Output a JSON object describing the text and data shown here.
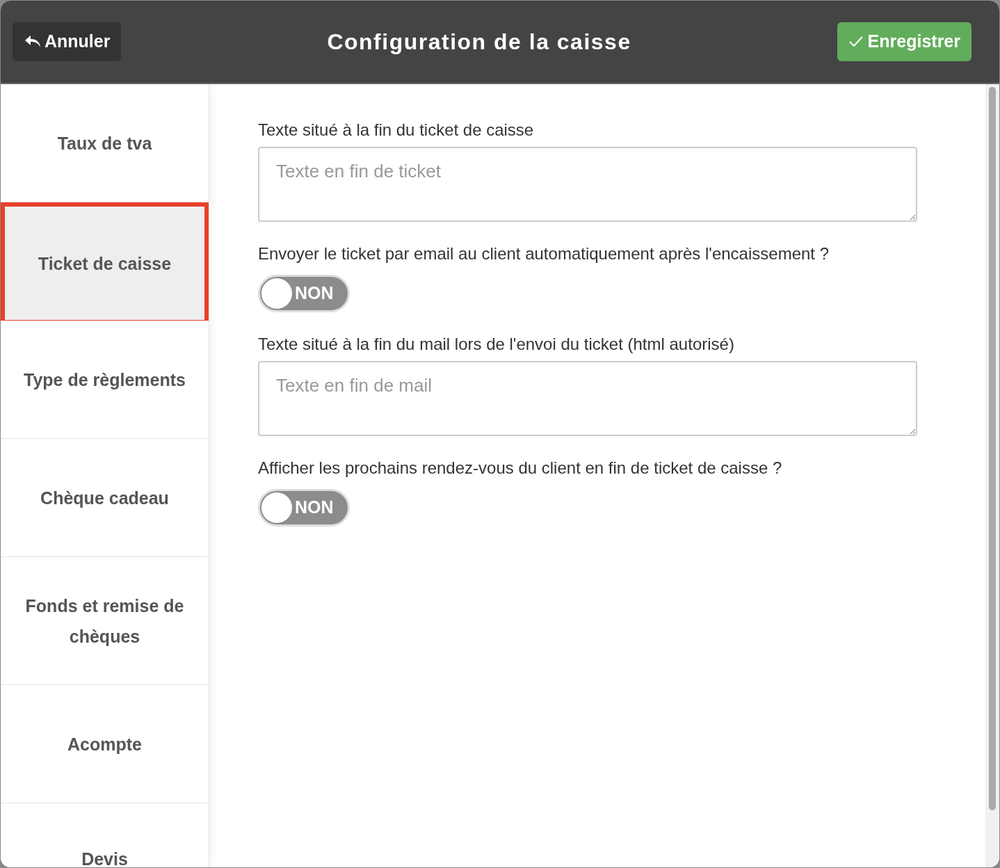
{
  "header": {
    "cancel_button": "Annuler",
    "title": "Configuration de la caisse",
    "save_button": "Enregistrer"
  },
  "sidebar": {
    "items": [
      {
        "label": "Taux de tva",
        "selected": false
      },
      {
        "label": "Ticket de caisse",
        "selected": true
      },
      {
        "label": "Type de règlements",
        "selected": false
      },
      {
        "label": "Chèque cadeau",
        "selected": false
      },
      {
        "label": "Fonds et remise de chèques",
        "selected": false
      },
      {
        "label": "Acompte",
        "selected": false
      },
      {
        "label": "Devis",
        "selected": false
      }
    ]
  },
  "fields": [
    {
      "kind": "textarea",
      "label": "Texte situé à la fin du ticket de caisse",
      "placeholder": "Texte en fin de ticket"
    },
    {
      "kind": "toggle",
      "label": "Envoyer le ticket par email au client automatiquement après l'encaissement ?",
      "on": false,
      "state_text": "NON"
    },
    {
      "kind": "textarea",
      "label": "Texte situé à la fin du mail lors de l'envoi du ticket (html autorisé)",
      "placeholder": "Texte en fin de mail"
    },
    {
      "kind": "toggle",
      "label": "Afficher les prochains rendez-vous du client en fin de ticket de caisse ?",
      "on": false,
      "state_text": "NON"
    }
  ]
}
